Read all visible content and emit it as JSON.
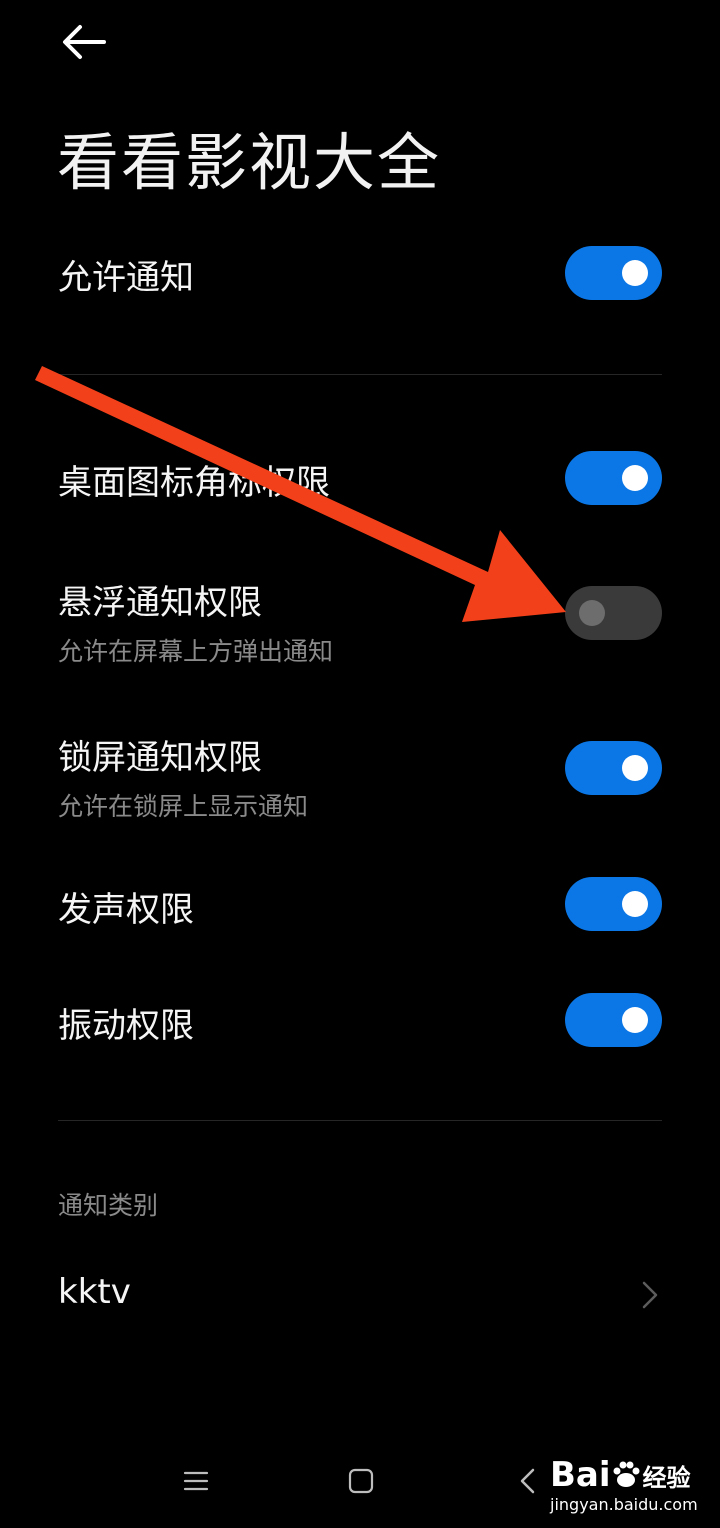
{
  "header": {
    "title": "看看影视大全"
  },
  "settings": {
    "allow": {
      "label": "允许通知",
      "enabled": true
    },
    "badge": {
      "label": "桌面图标角标权限",
      "enabled": true
    },
    "floating": {
      "label": "悬浮通知权限",
      "sub": "允许在屏幕上方弹出通知",
      "enabled": false
    },
    "lockscreen": {
      "label": "锁屏通知权限",
      "sub": "允许在锁屏上显示通知",
      "enabled": true
    },
    "sound": {
      "label": "发声权限",
      "enabled": true
    },
    "vibrate": {
      "label": "振动权限",
      "enabled": true
    }
  },
  "categories": {
    "header": "通知类别",
    "items": [
      {
        "label": "kktv"
      }
    ]
  },
  "watermark": {
    "brand": "Bai",
    "brand_suffix": "经验",
    "url": "jingyan.baidu.com"
  },
  "colors": {
    "toggle_on": "#0b77e6",
    "toggle_off": "#3a3a3a",
    "arrow": "#f2411a",
    "background": "#000000"
  }
}
